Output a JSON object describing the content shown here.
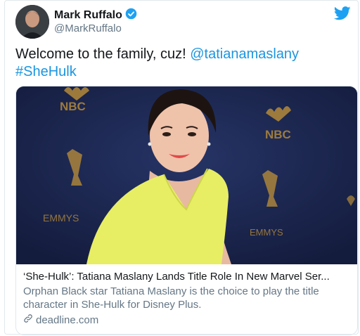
{
  "author": {
    "name": "Mark Ruffalo",
    "handle": "@MarkRuffalo",
    "verified": true
  },
  "tweet": {
    "text_prefix": "Welcome to the family, cuz! ",
    "mention": "@tatianamaslany",
    "hashtag": "#SheHulk"
  },
  "card": {
    "image_text": {
      "nbc_left": "NBC",
      "nbc_right": "NBC",
      "emmys_left": "EMMYS",
      "emmys_right": "EMMYS"
    },
    "title": "‘She-Hulk’: Tatiana Maslany Lands Title Role In New Marvel Ser...",
    "description": "Orphan Black star Tatiana Maslany is the choice to play the title character in She-Hulk for Disney Plus.",
    "domain": "deadline.com"
  },
  "colors": {
    "link": "#1b95e0",
    "twitter_blue": "#1da1f2",
    "text_secondary": "#657786"
  },
  "icons": {
    "verified": "verified-badge-icon",
    "bird": "twitter-bird-icon",
    "link": "link-icon"
  }
}
